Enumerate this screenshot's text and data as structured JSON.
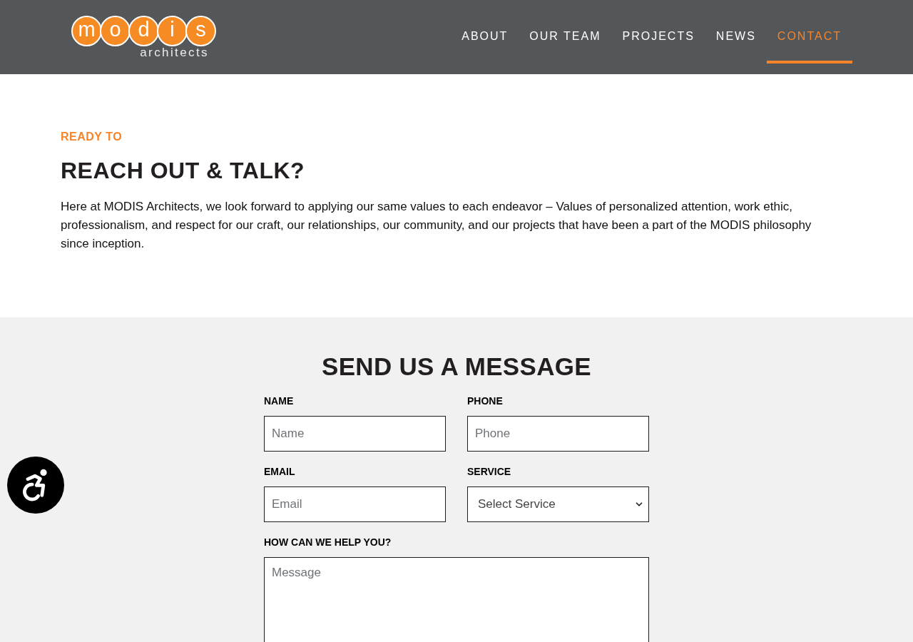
{
  "logo": {
    "letters": [
      "m",
      "o",
      "d",
      "i",
      "s"
    ],
    "tagline": "architects"
  },
  "nav": [
    {
      "label": "ABOUT",
      "selected": false
    },
    {
      "label": "OUR TEAM",
      "selected": false
    },
    {
      "label": "PROJECTS",
      "selected": false
    },
    {
      "label": "NEWS",
      "selected": false
    },
    {
      "label": "CONTACT",
      "selected": true
    }
  ],
  "intro": {
    "eyebrow": "READY TO",
    "heading": "REACH OUT & TALK?",
    "body": "Here at MODIS Architects, we look forward to applying our same values to each endeavor – Values of personalized attention, work ethic, professionalism, and respect for our craft, our relationships, our community, and our projects that have been a part of the MODIS philosophy since inception."
  },
  "form": {
    "title": "SEND US A MESSAGE",
    "fields": [
      {
        "kind": "input",
        "label": "NAME",
        "placeholder": "Name"
      },
      {
        "kind": "input",
        "label": "PHONE",
        "placeholder": "Phone"
      },
      {
        "kind": "input",
        "label": "EMAIL",
        "placeholder": "Email"
      },
      {
        "kind": "select",
        "label": "SERVICE",
        "value": "Select Service"
      },
      {
        "kind": "textarea",
        "label": "HOW CAN WE HELP YOU?",
        "placeholder": "Message"
      }
    ]
  }
}
